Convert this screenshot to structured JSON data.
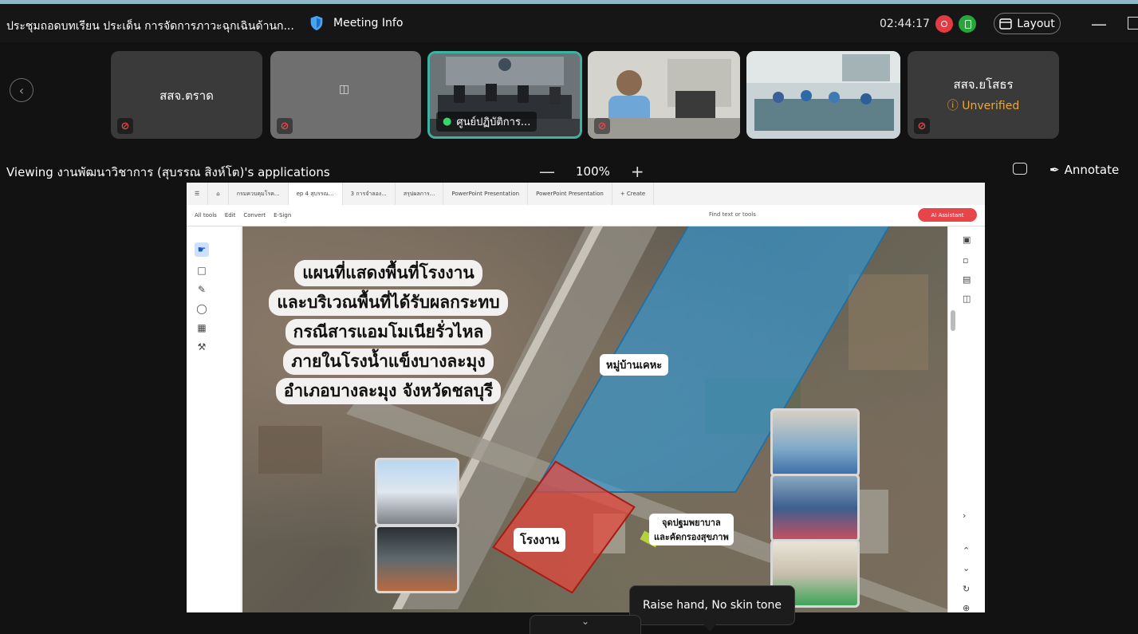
{
  "meeting": {
    "title": "ประชุมถอดบทเรียน ประเด็น การจัดการภาวะฉุกเฉินด้านก...",
    "info_label": "Meeting Info",
    "timer": "02:44:17",
    "layout_label": "Layout"
  },
  "participants": [
    {
      "name": "สสจ.ตราด",
      "muted": true,
      "video": false
    },
    {
      "name": "",
      "muted": true,
      "video": false
    },
    {
      "name": "ศูนย์ปฏิบัติการ...",
      "muted": false,
      "video": true,
      "active_speaker": true
    },
    {
      "name": "",
      "muted": true,
      "video": true
    },
    {
      "name": "",
      "muted": false,
      "video": true
    },
    {
      "name": "สสจ.ยโสธร",
      "status": "Unverified",
      "muted": true,
      "video": false
    }
  ],
  "share": {
    "viewing_label": "Viewing งานพัฒนาวิชาการ (สุบรรณ สิงห์โต)'s applications",
    "zoom_minus": "—",
    "zoom_value": "100%",
    "zoom_plus": "+",
    "annotate_label": "Annotate"
  },
  "app": {
    "tabs": [
      "กรมควบคุมโรค...",
      "ep 4 สุบรรณ...",
      "3 การจำลอง...",
      "สรุปผลการ...",
      "PowerPoint Presentation",
      "PowerPoint Presentation",
      "+ Create"
    ],
    "toolbar": [
      "All tools",
      "Edit",
      "Convert",
      "E-Sign"
    ],
    "find_placeholder": "Find text or tools",
    "ai_label": "AI Assistant"
  },
  "slide": {
    "title_lines": [
      "แผนที่แสดงพื้นที่โรงงาน",
      "และบริเวณพื้นที่ได้รับผลกระทบ",
      "กรณีสารแอมโมเนียรั่วไหล",
      "ภายในโรงน้ำแข็งบางละมุง",
      "อำเภอบางละมุง จังหวัดชลบุรี"
    ],
    "village_label": "หมู่บ้านเคหะ",
    "factory_label": "โรงงาน",
    "firstaid_line1": "จุดปฐมพยาบาล",
    "firstaid_line2": "และคัดกรองสุขภาพ"
  },
  "tooltip": "Raise hand, No skin tone",
  "colors": {
    "accent_teal": "#3bb3a0",
    "unverified": "#e7a93a",
    "ai_red": "#e8454a",
    "zone_blue": "#2f9bdc",
    "zone_red": "#e6463c"
  }
}
